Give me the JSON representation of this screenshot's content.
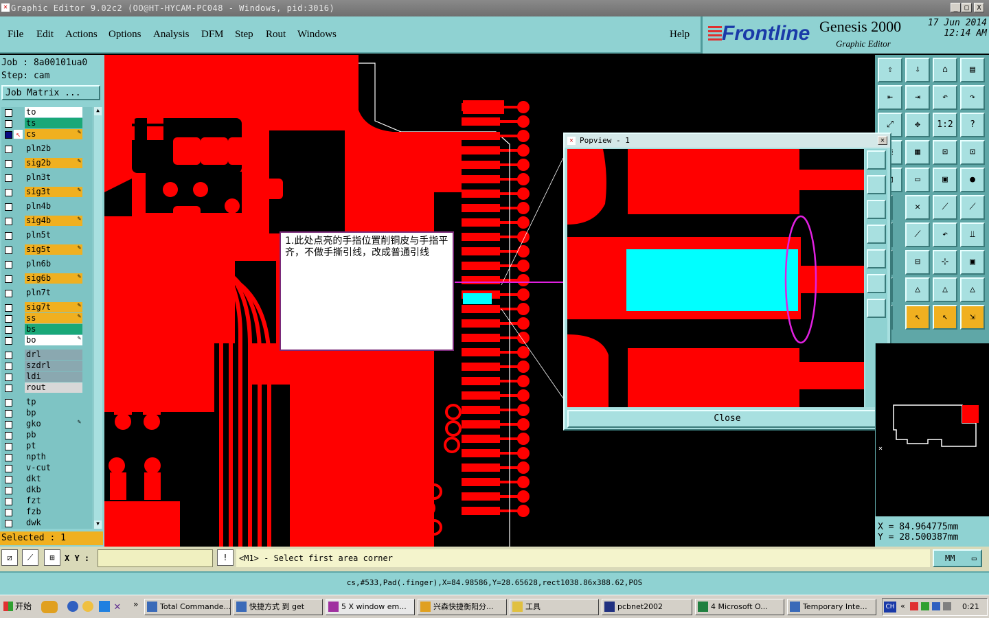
{
  "window": {
    "title": "Graphic Editor 9.02c2 (OO@HT-HYCAM-PC048 - Windows, pid:3016)",
    "min_label": "_",
    "max_label": "□",
    "close_label": "X"
  },
  "menu": {
    "items": [
      "File",
      "Edit",
      "Actions",
      "Options",
      "Analysis",
      "DFM",
      "Step",
      "Rout",
      "Windows"
    ],
    "help": "Help"
  },
  "brand": {
    "logo": "Frontline",
    "product": "Genesis 2000",
    "subtitle": "Graphic Editor",
    "date": "17 Jun 2014",
    "time": "12:14 AM"
  },
  "left": {
    "job": "Job : 8a00101ua0",
    "step": "Step: cam",
    "job_matrix": "Job Matrix ...",
    "layers": [
      {
        "name": "to",
        "color": "#ffffff",
        "checked": false,
        "edit": ""
      },
      {
        "name": "ts",
        "color": "#1aa878",
        "checked": false,
        "edit": ""
      },
      {
        "name": "cs",
        "color": "#f0b020",
        "checked": true,
        "edit": "✎"
      },
      {
        "name": "pln2b",
        "color": "#7ec4c4",
        "checked": false,
        "edit": ""
      },
      {
        "name": "sig2b",
        "color": "#f0b020",
        "checked": false,
        "edit": "✎"
      },
      {
        "name": "pln3t",
        "color": "#7ec4c4",
        "checked": false,
        "edit": ""
      },
      {
        "name": "sig3t",
        "color": "#f0b020",
        "checked": false,
        "edit": "✎"
      },
      {
        "name": "pln4b",
        "color": "#7ec4c4",
        "checked": false,
        "edit": ""
      },
      {
        "name": "sig4b",
        "color": "#f0b020",
        "checked": false,
        "edit": "✎"
      },
      {
        "name": "pln5t",
        "color": "#7ec4c4",
        "checked": false,
        "edit": ""
      },
      {
        "name": "sig5t",
        "color": "#f0b020",
        "checked": false,
        "edit": "✎"
      },
      {
        "name": "pln6b",
        "color": "#7ec4c4",
        "checked": false,
        "edit": ""
      },
      {
        "name": "sig6b",
        "color": "#f0b020",
        "checked": false,
        "edit": "✎"
      },
      {
        "name": "pln7t",
        "color": "#7ec4c4",
        "checked": false,
        "edit": ""
      },
      {
        "name": "sig7t",
        "color": "#f0b020",
        "checked": false,
        "edit": "✎"
      },
      {
        "name": "ss",
        "color": "#f0b020",
        "checked": false,
        "edit": "✎"
      },
      {
        "name": "bs",
        "color": "#1aa878",
        "checked": false,
        "edit": ""
      },
      {
        "name": "bo",
        "color": "#ffffff",
        "checked": false,
        "edit": "✎"
      },
      {
        "name": "drl",
        "color": "#8aa8b0",
        "checked": false,
        "edit": ""
      },
      {
        "name": "szdrl",
        "color": "#8aa8b0",
        "checked": false,
        "edit": ""
      },
      {
        "name": "ldi",
        "color": "#8aa8b0",
        "checked": false,
        "edit": ""
      },
      {
        "name": "rout",
        "color": "#d8d8d8",
        "checked": false,
        "edit": ""
      },
      {
        "name": "tp",
        "color": "#7ec4c4",
        "checked": false,
        "edit": ""
      },
      {
        "name": "bp",
        "color": "#7ec4c4",
        "checked": false,
        "edit": ""
      },
      {
        "name": "gko",
        "color": "#7ec4c4",
        "checked": false,
        "edit": "✎"
      },
      {
        "name": "pb",
        "color": "#7ec4c4",
        "checked": false,
        "edit": ""
      },
      {
        "name": "pt",
        "color": "#7ec4c4",
        "checked": false,
        "edit": ""
      },
      {
        "name": "npth",
        "color": "#7ec4c4",
        "checked": false,
        "edit": ""
      },
      {
        "name": "v-cut",
        "color": "#7ec4c4",
        "checked": false,
        "edit": ""
      },
      {
        "name": "dkt",
        "color": "#7ec4c4",
        "checked": false,
        "edit": ""
      },
      {
        "name": "dkb",
        "color": "#7ec4c4",
        "checked": false,
        "edit": ""
      },
      {
        "name": "fzt",
        "color": "#7ec4c4",
        "checked": false,
        "edit": ""
      },
      {
        "name": "fzb",
        "color": "#7ec4c4",
        "checked": false,
        "edit": ""
      },
      {
        "name": "dwk",
        "color": "#7ec4c4",
        "checked": false,
        "edit": ""
      }
    ],
    "selected": "Selected : 1"
  },
  "note": {
    "text": "1.此处点亮的手指位置削铜皮与手指平齐，不做手撕引线，改成普通引线"
  },
  "popview": {
    "title": "Popview - 1",
    "close_button": "Close"
  },
  "coords": {
    "x": "X  = 84.964775mm",
    "y": "Y  = 28.500387mm"
  },
  "bottom": {
    "xy_label": "X Y :",
    "xy_value": "",
    "prompt": "<M1> - Select first area corner",
    "unit": "MM"
  },
  "status": {
    "text": "cs,#533,Pad(.finger),X=84.98586,Y=28.65628,rect1038.86x388.62,POS"
  },
  "taskbar": {
    "start": "开始",
    "tasks": [
      "Total Commande...",
      "快捷方式 到 get",
      "5 X window em...",
      "兴森快捷衡阳分...",
      "工具",
      "pcbnet2002",
      "4 Microsoft O...",
      "Temporary Inte..."
    ],
    "ime": "CH",
    "clock": "0:21"
  },
  "colors": {
    "copper": "#ff0000",
    "highlight": "#00ffff",
    "annotation": "#e020e0",
    "panel": "#8fd2d2"
  }
}
